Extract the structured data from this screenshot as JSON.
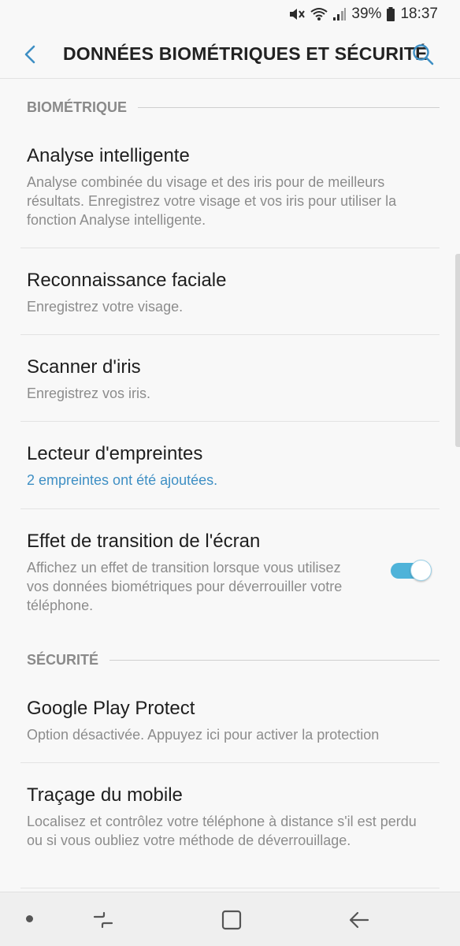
{
  "status_bar": {
    "battery": "39%",
    "time": "18:37"
  },
  "header": {
    "title": "DONNÉES BIOMÉTRIQUES ET SÉCURITÉ"
  },
  "sections": {
    "biometric": {
      "label": "BIOMÉTRIQUE",
      "items": [
        {
          "title": "Analyse intelligente",
          "subtitle": "Analyse combinée du visage et des iris pour de meilleurs résultats. Enregistrez votre visage et vos iris pour utiliser la fonction Analyse intelligente."
        },
        {
          "title": "Reconnaissance faciale",
          "subtitle": "Enregistrez votre visage."
        },
        {
          "title": "Scanner d'iris",
          "subtitle": "Enregistrez vos iris."
        },
        {
          "title": "Lecteur d'empreintes",
          "subtitle": "2 empreintes ont été ajoutées."
        },
        {
          "title": "Effet de transition de l'écran",
          "subtitle": "Affichez un effet de transition lorsque vous utilisez vos données biométriques pour déverrouiller votre téléphone.",
          "toggle_on": true
        }
      ]
    },
    "security": {
      "label": "SÉCURITÉ",
      "items": [
        {
          "title": "Google Play Protect",
          "subtitle": "Option désactivée. Appuyez ici pour activer la protection"
        },
        {
          "title": "Traçage du mobile",
          "subtitle": "Localisez et contrôlez votre téléphone à distance s'il est perdu ou si vous oubliez votre méthode de déverrouillage."
        }
      ]
    }
  },
  "icons": {
    "back": "back-arrow-icon",
    "search": "search-icon",
    "mute": "mute-icon",
    "wifi": "wifi-icon",
    "signal": "signal-icon",
    "battery": "battery-icon",
    "nav_dot": "nav-dot-icon",
    "recents": "recents-icon",
    "home": "home-icon",
    "nav_back": "nav-back-icon"
  },
  "colors": {
    "accent": "#3e8fc4",
    "toggle": "#4fb3d9"
  }
}
